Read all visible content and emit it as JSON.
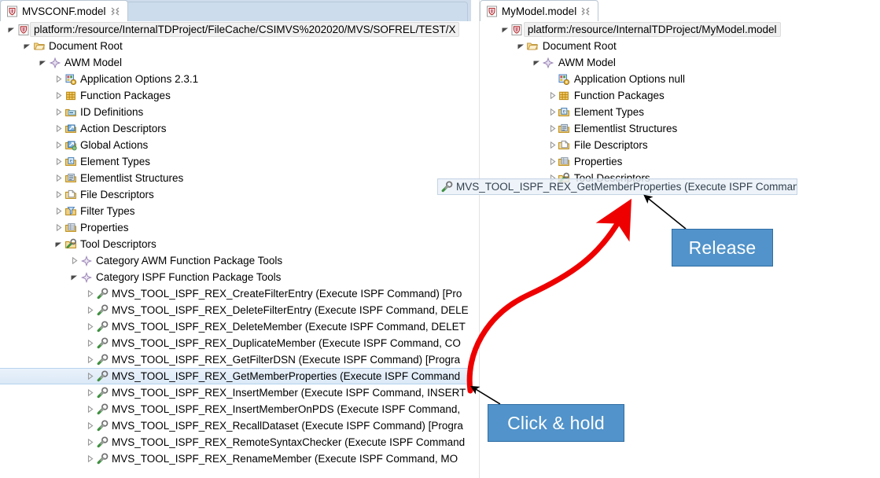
{
  "left_editor": {
    "tab": {
      "title": "MVSCONF.model",
      "icon": "ecore-model-icon",
      "close_icon": "close-icon"
    },
    "tree": [
      {
        "label": "platform:/resource/InternalTDProject/FileCache/CSIMVS%202020/MVS/SOFREL/TEST/X",
        "indent": 0,
        "twisty": "expanded",
        "icon": "ecore-model-icon",
        "root": true
      },
      {
        "label": "Document Root",
        "indent": 1,
        "twisty": "expanded",
        "icon": "document-root-icon"
      },
      {
        "label": "AWM Model",
        "indent": 2,
        "twisty": "expanded",
        "icon": "awm-model-icon"
      },
      {
        "label": "Application Options 2.3.1",
        "indent": 3,
        "twisty": "collapsed",
        "icon": "application-options-icon"
      },
      {
        "label": "Function Packages",
        "indent": 3,
        "twisty": "collapsed",
        "icon": "function-packages-icon"
      },
      {
        "label": "ID Definitions",
        "indent": 3,
        "twisty": "collapsed",
        "icon": "id-definitions-icon"
      },
      {
        "label": "Action Descriptors",
        "indent": 3,
        "twisty": "collapsed",
        "icon": "action-descriptors-icon"
      },
      {
        "label": "Global Actions",
        "indent": 3,
        "twisty": "collapsed",
        "icon": "global-actions-icon"
      },
      {
        "label": "Element Types",
        "indent": 3,
        "twisty": "collapsed",
        "icon": "element-types-icon"
      },
      {
        "label": "Elementlist Structures",
        "indent": 3,
        "twisty": "collapsed",
        "icon": "elementlist-structures-icon"
      },
      {
        "label": "File Descriptors",
        "indent": 3,
        "twisty": "collapsed",
        "icon": "file-descriptors-icon"
      },
      {
        "label": "Filter Types",
        "indent": 3,
        "twisty": "collapsed",
        "icon": "filter-types-icon"
      },
      {
        "label": "Properties",
        "indent": 3,
        "twisty": "collapsed",
        "icon": "properties-icon"
      },
      {
        "label": "Tool Descriptors",
        "indent": 3,
        "twisty": "expanded",
        "icon": "tool-descriptors-icon"
      },
      {
        "label": "Category AWM Function Package Tools",
        "indent": 4,
        "twisty": "collapsed",
        "icon": "category-icon"
      },
      {
        "label": "Category ISPF Function Package Tools",
        "indent": 4,
        "twisty": "expanded",
        "icon": "category-icon"
      },
      {
        "label": "MVS_TOOL_ISPF_REX_CreateFilterEntry (Execute ISPF Command) [Pro",
        "indent": 5,
        "twisty": "collapsed",
        "icon": "tool-icon"
      },
      {
        "label": "MVS_TOOL_ISPF_REX_DeleteFilterEntry (Execute ISPF Command, DELE",
        "indent": 5,
        "twisty": "collapsed",
        "icon": "tool-icon"
      },
      {
        "label": "MVS_TOOL_ISPF_REX_DeleteMember (Execute ISPF Command, DELET",
        "indent": 5,
        "twisty": "collapsed",
        "icon": "tool-icon"
      },
      {
        "label": "MVS_TOOL_ISPF_REX_DuplicateMember (Execute ISPF Command, CO",
        "indent": 5,
        "twisty": "collapsed",
        "icon": "tool-icon"
      },
      {
        "label": "MVS_TOOL_ISPF_REX_GetFilterDSN (Execute ISPF Command) [Progra",
        "indent": 5,
        "twisty": "collapsed",
        "icon": "tool-icon"
      },
      {
        "label": "MVS_TOOL_ISPF_REX_GetMemberProperties (Execute ISPF Command",
        "indent": 5,
        "twisty": "collapsed",
        "icon": "tool-icon",
        "selected": true
      },
      {
        "label": "MVS_TOOL_ISPF_REX_InsertMember (Execute ISPF Command, INSERT",
        "indent": 5,
        "twisty": "collapsed",
        "icon": "tool-icon"
      },
      {
        "label": "MVS_TOOL_ISPF_REX_InsertMemberOnPDS (Execute ISPF Command,",
        "indent": 5,
        "twisty": "collapsed",
        "icon": "tool-icon"
      },
      {
        "label": "MVS_TOOL_ISPF_REX_RecallDataset (Execute ISPF Command) [Progra",
        "indent": 5,
        "twisty": "collapsed",
        "icon": "tool-icon"
      },
      {
        "label": "MVS_TOOL_ISPF_REX_RemoteSyntaxChecker (Execute ISPF Command",
        "indent": 5,
        "twisty": "collapsed",
        "icon": "tool-icon"
      },
      {
        "label": "MVS_TOOL_ISPF_REX_RenameMember (Execute ISPF Command, MO",
        "indent": 5,
        "twisty": "collapsed",
        "icon": "tool-icon"
      }
    ]
  },
  "right_editor": {
    "tab": {
      "title": "MyModel.model",
      "icon": "ecore-model-icon",
      "close_icon": "close-icon"
    },
    "tree": [
      {
        "label": "platform:/resource/InternalTDProject/MyModel.model",
        "indent": 0,
        "twisty": "expanded",
        "icon": "ecore-model-icon",
        "root": true
      },
      {
        "label": "Document Root",
        "indent": 1,
        "twisty": "expanded",
        "icon": "document-root-icon"
      },
      {
        "label": "AWM Model",
        "indent": 2,
        "twisty": "expanded",
        "icon": "awm-model-icon"
      },
      {
        "label": "Application Options null",
        "indent": 3,
        "twisty": "none",
        "icon": "application-options-icon"
      },
      {
        "label": "Function Packages",
        "indent": 3,
        "twisty": "collapsed",
        "icon": "function-packages-icon"
      },
      {
        "label": "Element Types",
        "indent": 3,
        "twisty": "collapsed",
        "icon": "element-types-icon"
      },
      {
        "label": "Elementlist Structures",
        "indent": 3,
        "twisty": "collapsed",
        "icon": "elementlist-structures-icon"
      },
      {
        "label": "File Descriptors",
        "indent": 3,
        "twisty": "collapsed",
        "icon": "file-descriptors-icon"
      },
      {
        "label": "Properties",
        "indent": 3,
        "twisty": "collapsed",
        "icon": "properties-icon"
      },
      {
        "label": "Tool Descriptors",
        "indent": 3,
        "twisty": "collapsed",
        "icon": "tool-descriptors-icon"
      }
    ]
  },
  "drag": {
    "ghost_label": "MVS_TOOL_ISPF_REX_GetMemberProperties (Execute ISPF Command",
    "ghost_icon": "tool-icon"
  },
  "annotations": {
    "click_hold": {
      "label": "Click & hold"
    },
    "release": {
      "label": "Release"
    },
    "colors": {
      "callout_fill": "#5193ca",
      "callout_border": "#2f6ea4",
      "callout_text": "#ffffff",
      "drag_arrow": "#ee0000",
      "pointer_line": "#000000"
    }
  }
}
